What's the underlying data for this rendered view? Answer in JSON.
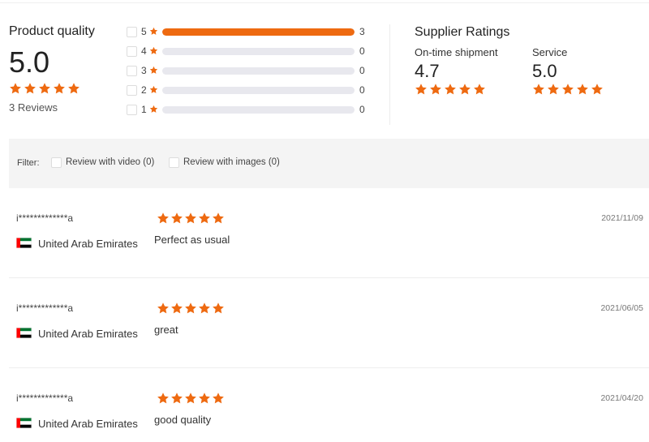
{
  "colors": {
    "accent": "#ee6a11",
    "track": "#e8e8ee",
    "filter_bg": "#f4f4f4"
  },
  "product_quality": {
    "title": "Product quality",
    "score": "5.0",
    "stars": 5,
    "reviews_label": "3 Reviews"
  },
  "distribution": [
    {
      "stars": "5",
      "count": "3",
      "fraction": 1.0
    },
    {
      "stars": "4",
      "count": "0",
      "fraction": 0
    },
    {
      "stars": "3",
      "count": "0",
      "fraction": 0
    },
    {
      "stars": "2",
      "count": "0",
      "fraction": 0
    },
    {
      "stars": "1",
      "count": "0",
      "fraction": 0
    }
  ],
  "supplier": {
    "title": "Supplier Ratings",
    "metrics": [
      {
        "label": "On-time shipment",
        "value": "4.7",
        "stars": 5
      },
      {
        "label": "Service",
        "value": "5.0",
        "stars": 5
      }
    ]
  },
  "filter": {
    "label": "Filter:",
    "options": [
      {
        "label": "Review with video (0)"
      },
      {
        "label": "Review with images (0)"
      }
    ]
  },
  "reviews": [
    {
      "user": "i*************a",
      "country": "United Arab Emirates",
      "stars": 5,
      "text": "Perfect as usual",
      "date": "2021/11/09"
    },
    {
      "user": "i*************a",
      "country": "United Arab Emirates",
      "stars": 5,
      "text": "great",
      "date": "2021/06/05"
    },
    {
      "user": "i*************a",
      "country": "United Arab Emirates",
      "stars": 5,
      "text": "good quality",
      "date": "2021/04/20"
    }
  ]
}
